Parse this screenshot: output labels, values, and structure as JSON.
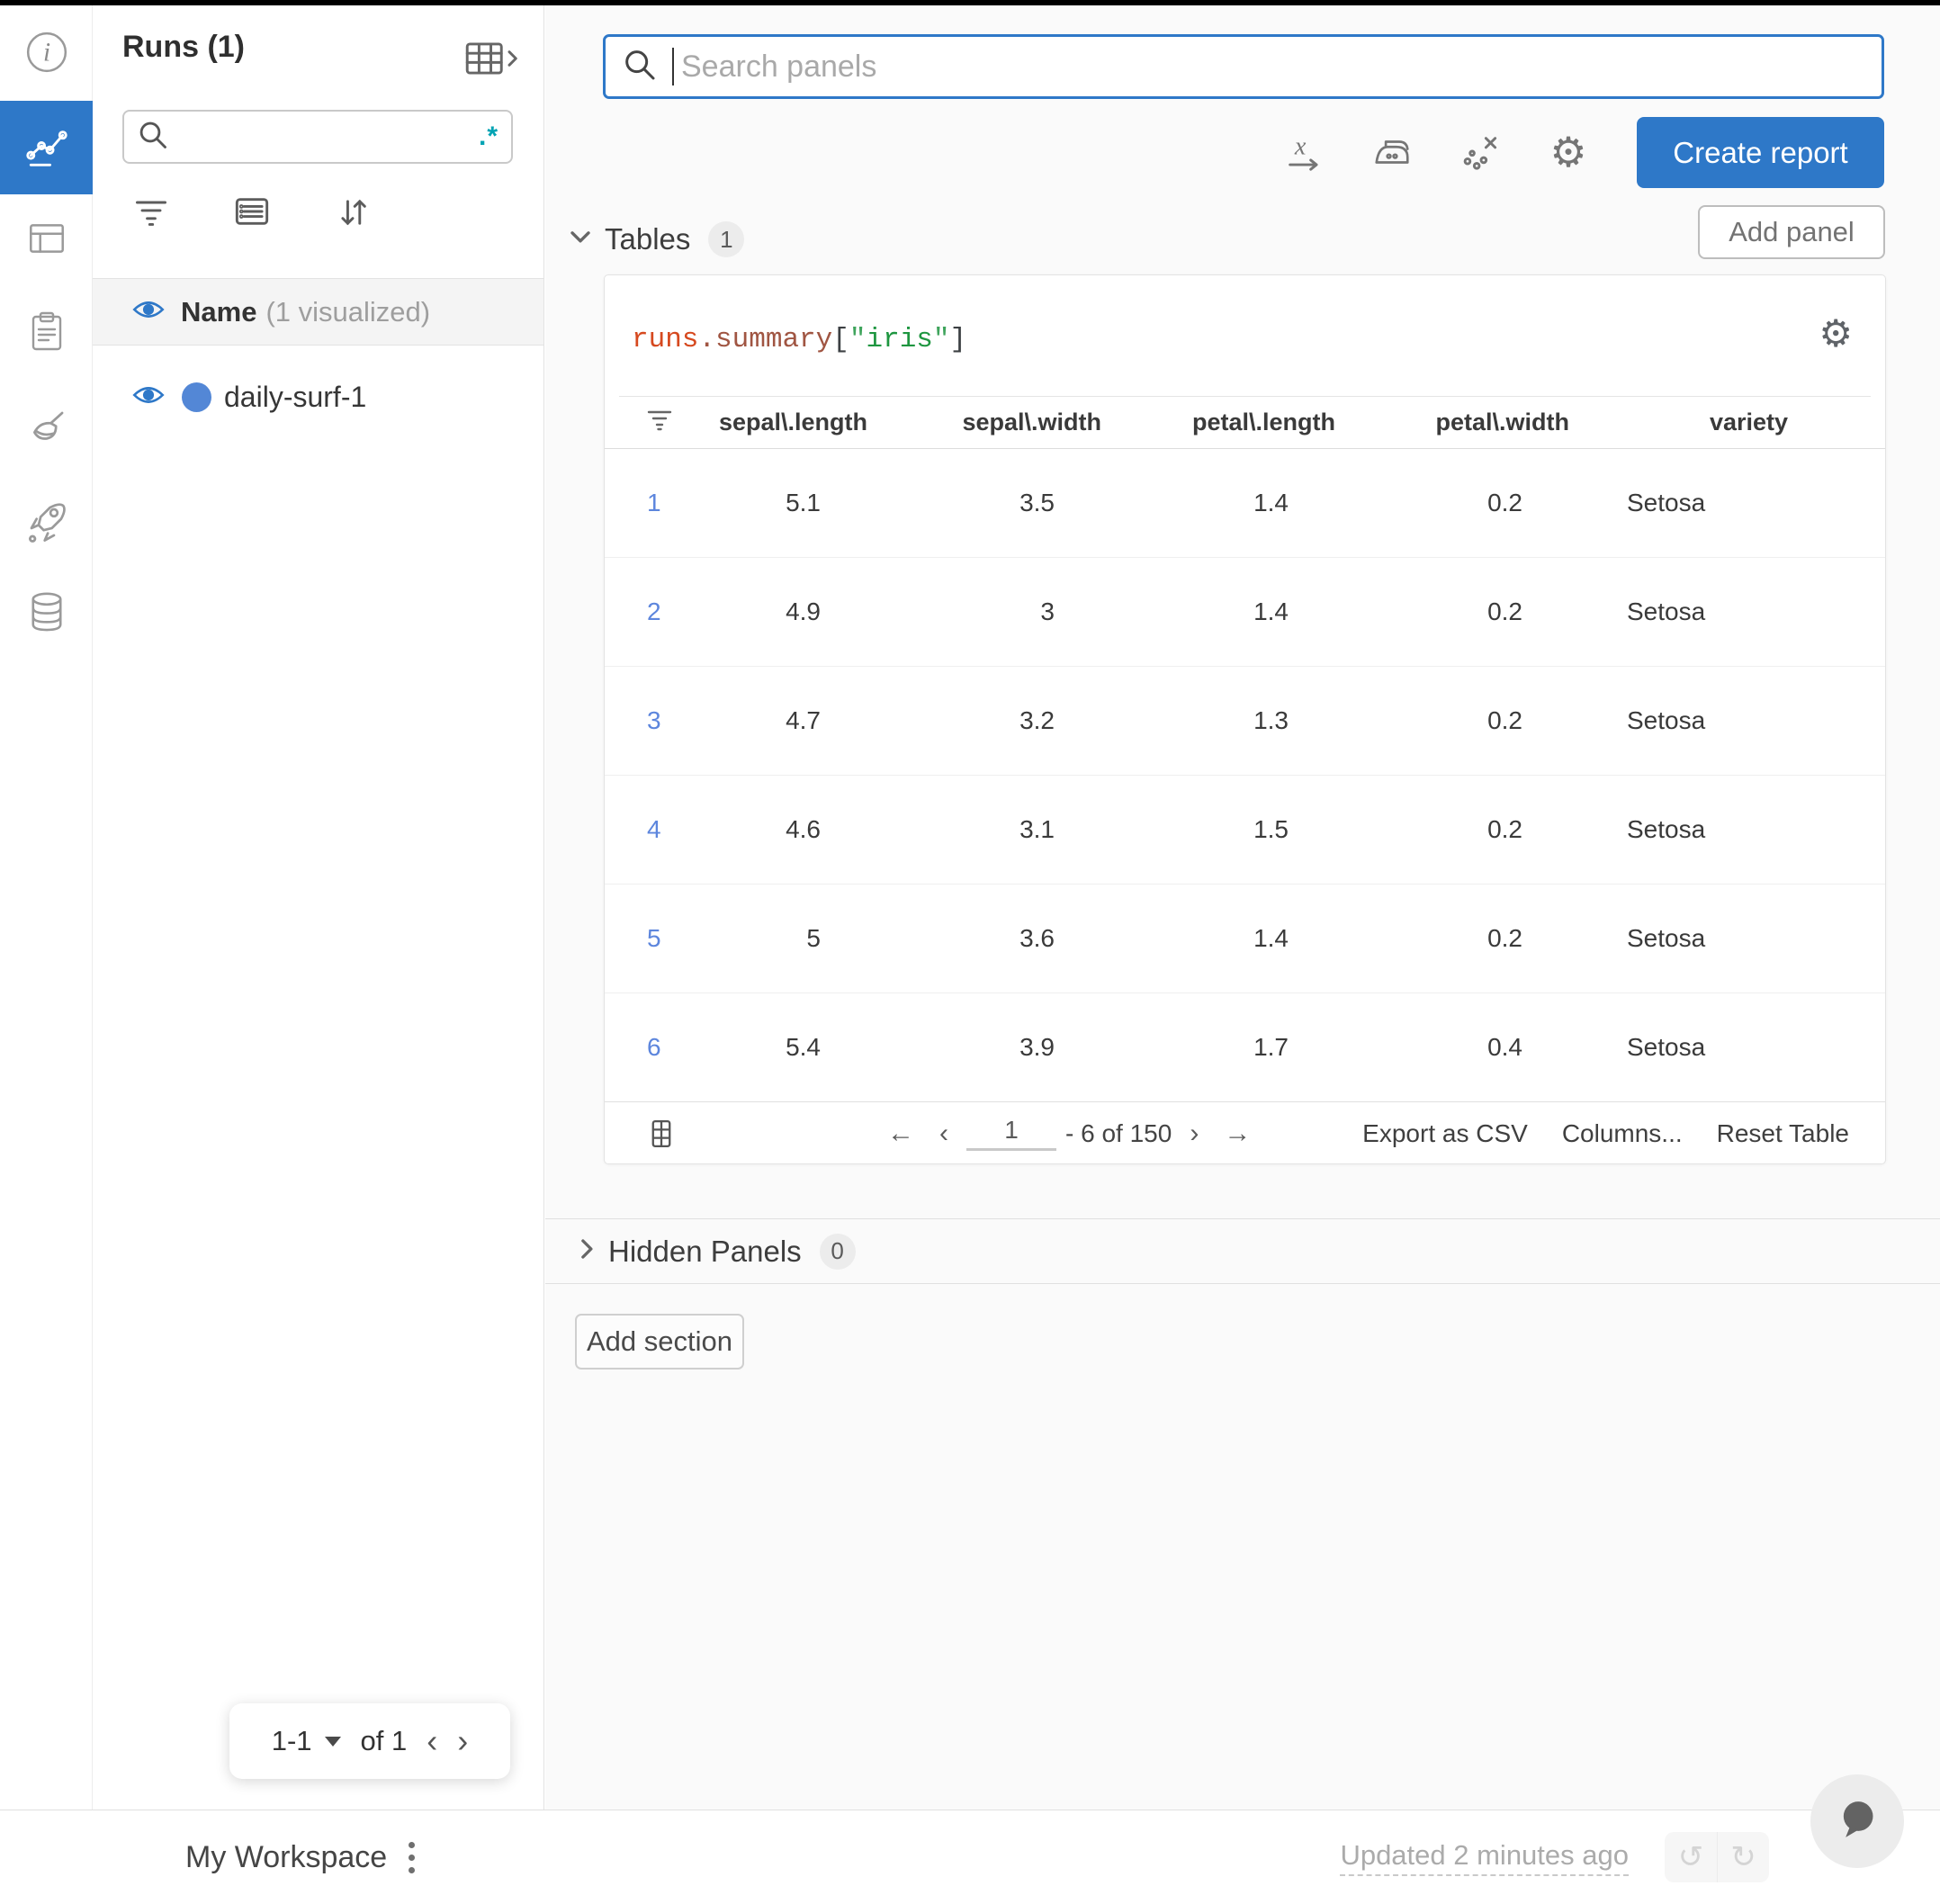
{
  "colors": {
    "accent": "#2e78c8",
    "run_dot": "#5387d6",
    "regex_teal": "#00a3b3",
    "row_index_blue": "#5d86dd",
    "code_object": "#d6491f",
    "code_property": "#a05542",
    "code_string": "#1e9640"
  },
  "rail": {
    "icons": [
      "info-icon",
      "line-chart-icon",
      "panels-icon",
      "clipboard-icon",
      "broom-icon",
      "rocket-icon",
      "database-icon"
    ]
  },
  "sidebar": {
    "title": "Runs (1)",
    "search_value": "",
    "regex_label": ".*",
    "visibility_header": {
      "label": "Name",
      "suffix": "(1 visualized)"
    },
    "run": {
      "name": "daily-surf-1"
    },
    "pager": {
      "range": "1-1",
      "of": "of 1",
      "prev": "‹",
      "next": "›"
    }
  },
  "main": {
    "search": {
      "placeholder": "Search panels"
    },
    "create_report_label": "Create report",
    "add_panel_label": "Add panel",
    "tables_section": {
      "label": "Tables",
      "count": "1"
    },
    "hidden_section": {
      "label": "Hidden Panels",
      "count": "0"
    },
    "add_section_label": "Add section",
    "panel": {
      "code": {
        "obj": "runs",
        "dot": ".",
        "prop": "summary",
        "lb": "[",
        "q1": "\"",
        "key": "iris",
        "q2": "\"",
        "rb": "]"
      },
      "table": {
        "columns": [
          "sepal\\.length",
          "sepal\\.width",
          "petal\\.length",
          "petal\\.width",
          "variety"
        ],
        "rows": [
          [
            "1",
            "5.1",
            "3.5",
            "1.4",
            "0.2",
            "Setosa"
          ],
          [
            "2",
            "4.9",
            "3",
            "1.4",
            "0.2",
            "Setosa"
          ],
          [
            "3",
            "4.7",
            "3.2",
            "1.3",
            "0.2",
            "Setosa"
          ],
          [
            "4",
            "4.6",
            "3.1",
            "1.5",
            "0.2",
            "Setosa"
          ],
          [
            "5",
            "5",
            "3.6",
            "1.4",
            "0.2",
            "Setosa"
          ],
          [
            "6",
            "5.4",
            "3.9",
            "1.7",
            "0.4",
            "Setosa"
          ]
        ],
        "footer": {
          "first": "←",
          "prev": "‹",
          "page": "1",
          "range": "- 6 of 150",
          "next": "›",
          "last": "→",
          "export_label": "Export as CSV",
          "columns_label": "Columns...",
          "reset_label": "Reset Table"
        }
      }
    }
  },
  "bottom_bar": {
    "workspace": "My Workspace",
    "updated": "Updated 2 minutes ago"
  }
}
